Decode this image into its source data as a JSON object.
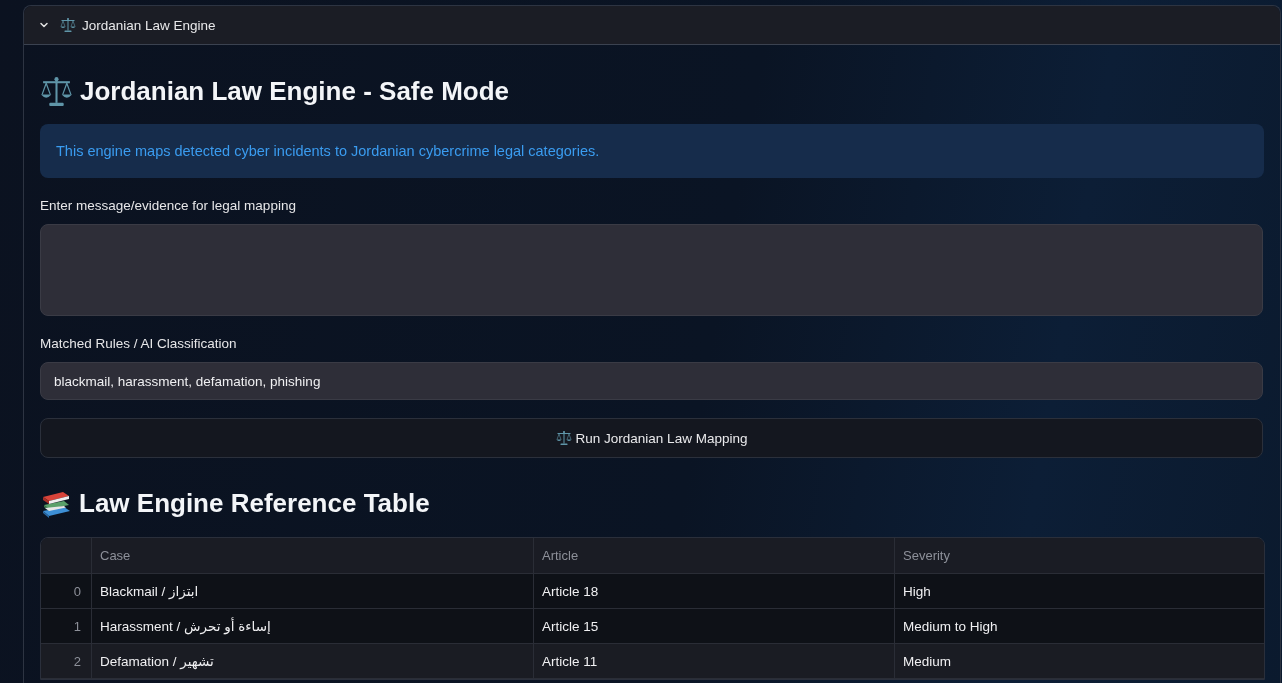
{
  "expander": {
    "title": "Jordanian Law Engine",
    "expanded": true
  },
  "page_title": "Jordanian Law Engine - Safe Mode",
  "info": "This engine maps detected cyber incidents to Jordanian cybercrime legal categories.",
  "evidence_field": {
    "label": "Enter message/evidence for legal mapping"
  },
  "rules_field": {
    "label": "Matched Rules / AI Classification",
    "value": "blackmail, harassment, defamation, phishing"
  },
  "run_button": {
    "label": "Run Jordanian Law Mapping"
  },
  "reference": {
    "heading": "Law Engine Reference Table",
    "table": {
      "columns": [
        "Case",
        "Article",
        "Severity"
      ],
      "rows": [
        {
          "index": "0",
          "cells": [
            "Blackmail / ابتزاز",
            "Article 18",
            "High"
          ],
          "hovered": false
        },
        {
          "index": "1",
          "cells": [
            "Harassment / إساءة أو تحرش",
            "Article 15",
            "Medium to High"
          ],
          "hovered": false
        },
        {
          "index": "2",
          "cells": [
            "Defamation / تشهير",
            "Article 11",
            "Medium"
          ],
          "hovered": true
        }
      ]
    }
  }
}
